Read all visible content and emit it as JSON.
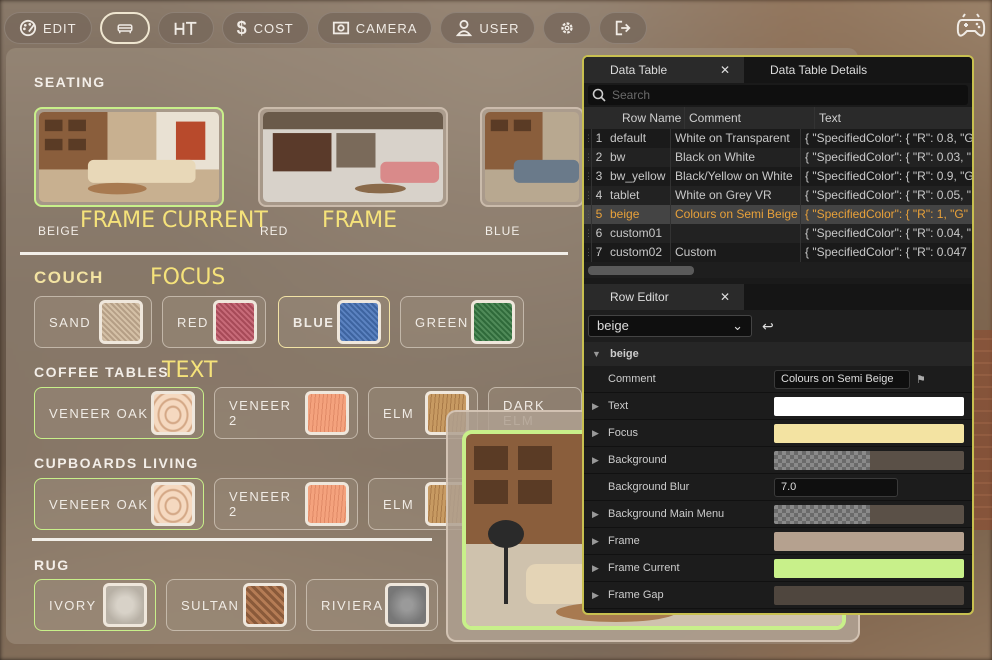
{
  "toolbar": {
    "items": [
      {
        "label": "EDIT",
        "icon": "palette-icon"
      },
      {
        "label": "",
        "icon": "sofa-icon"
      },
      {
        "label": "",
        "icon": "height-icon"
      },
      {
        "label": "COST",
        "icon": "dollar-icon"
      },
      {
        "label": "CAMERA",
        "icon": "camera-icon"
      },
      {
        "label": "USER",
        "icon": "user-icon"
      },
      {
        "label": "",
        "icon": "gear-icon"
      },
      {
        "label": "",
        "icon": "exit-icon"
      }
    ]
  },
  "panel": {
    "seating": {
      "title": "SEATING",
      "tiles": [
        {
          "label": "BEIGE"
        },
        {
          "label": "RED"
        },
        {
          "label": "BLUE"
        }
      ]
    },
    "annotations": {
      "frame_current": "FRAME CURRENT",
      "frame": "FRAME",
      "focus": "FOCUS",
      "text": "TEXT"
    },
    "couch": {
      "title": "COUCH",
      "options": [
        {
          "label": "SAND"
        },
        {
          "label": "RED"
        },
        {
          "label": "BLUE"
        },
        {
          "label": "GREEN"
        }
      ]
    },
    "coffee_tables": {
      "title": "COFFEE TABLES",
      "options": [
        {
          "label": "VENEER OAK"
        },
        {
          "label": "VENEER 2"
        },
        {
          "label": "ELM"
        },
        {
          "label": "DARK ELM"
        }
      ]
    },
    "cupboards": {
      "title": "CUPBOARDS LIVING",
      "options": [
        {
          "label": "VENEER OAK"
        },
        {
          "label": "VENEER 2"
        },
        {
          "label": "ELM"
        }
      ]
    },
    "rug": {
      "title": "RUG",
      "options": [
        {
          "label": "IVORY"
        },
        {
          "label": "SULTAN"
        },
        {
          "label": "RIVIERA"
        }
      ]
    }
  },
  "data_table": {
    "tabs": [
      "Data Table",
      "Data Table Details"
    ],
    "search_placeholder": "Search",
    "columns": [
      "Row Name",
      "Comment",
      "Text"
    ],
    "rows": [
      {
        "n": "1",
        "name": "default",
        "comment": "White on Transparent",
        "text": "{ \"SpecifiedColor\": { \"R\": 0.8, \"G\""
      },
      {
        "n": "2",
        "name": "bw",
        "comment": "Black on White",
        "text": "{ \"SpecifiedColor\": { \"R\": 0.03, \""
      },
      {
        "n": "3",
        "name": "bw_yellow",
        "comment": "Black/Yellow on White",
        "text": "{ \"SpecifiedColor\": { \"R\": 0.9, \"G\""
      },
      {
        "n": "4",
        "name": "tablet",
        "comment": "White on Grey VR",
        "text": "{ \"SpecifiedColor\": { \"R\": 0.05, \""
      },
      {
        "n": "5",
        "name": "beige",
        "comment": "Colours on Semi Beige",
        "text": "{ \"SpecifiedColor\": { \"R\": 1, \"G\""
      },
      {
        "n": "6",
        "name": "custom01",
        "comment": "",
        "text": "{ \"SpecifiedColor\": { \"R\": 0.04, \""
      },
      {
        "n": "7",
        "name": "custom02",
        "comment": "Custom",
        "text": "{ \"SpecifiedColor\": { \"R\": 0.047"
      }
    ]
  },
  "row_editor": {
    "tab": "Row Editor",
    "selected_row": "beige",
    "category": "beige",
    "properties": [
      {
        "name": "Comment",
        "kind": "text",
        "value": "Colours on Semi Beige",
        "expandable": false
      },
      {
        "name": "Text",
        "kind": "color",
        "color": "#ffffff",
        "expandable": true
      },
      {
        "name": "Focus",
        "kind": "color",
        "color": "#f3e3a2",
        "expandable": true
      },
      {
        "name": "Background",
        "kind": "checker",
        "expandable": true
      },
      {
        "name": "Background Blur",
        "kind": "number",
        "value": "7.0",
        "expandable": false
      },
      {
        "name": "Background Main Menu",
        "kind": "checker",
        "expandable": true
      },
      {
        "name": "Frame",
        "kind": "color",
        "color": "#b5a18f",
        "expandable": true
      },
      {
        "name": "Frame Current",
        "kind": "color",
        "color": "#c8f08a",
        "expandable": true
      },
      {
        "name": "Frame Gap",
        "kind": "color",
        "color": "#4f463e",
        "expandable": true
      }
    ]
  }
}
